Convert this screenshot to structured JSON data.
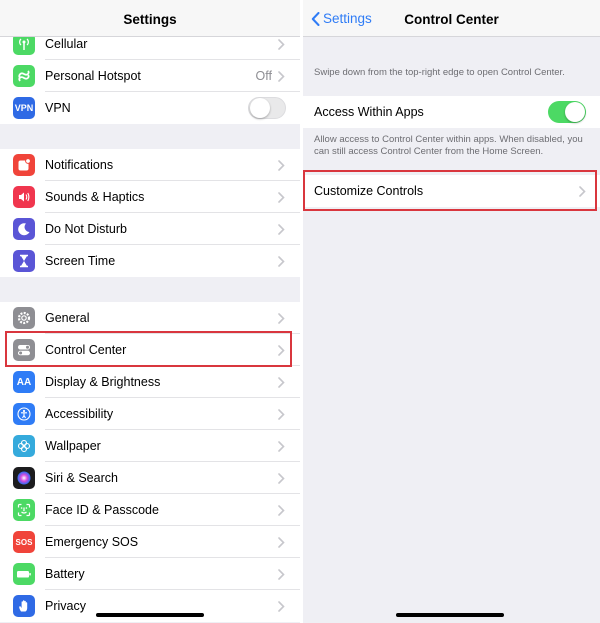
{
  "left": {
    "title": "Settings",
    "group1": [
      {
        "label": "Cellular",
        "icon": "antenna-icon",
        "color": "#4cd964"
      },
      {
        "label": "Personal Hotspot",
        "icon": "hotspot-icon",
        "color": "#4cd964",
        "value": "Off"
      },
      {
        "label": "VPN",
        "icon": "vpn-icon",
        "color": "#2f6ae5",
        "icon_text": "VPN",
        "toggle": "off"
      }
    ],
    "group2": [
      {
        "label": "Notifications",
        "icon": "notifications-icon",
        "color": "#f0443a"
      },
      {
        "label": "Sounds & Haptics",
        "icon": "speaker-icon",
        "color": "#f0364e"
      },
      {
        "label": "Do Not Disturb",
        "icon": "moon-icon",
        "color": "#5a55d6"
      },
      {
        "label": "Screen Time",
        "icon": "hourglass-icon",
        "color": "#5a55d6"
      }
    ],
    "group3": [
      {
        "label": "General",
        "icon": "gear-icon",
        "color": "#8e8e93"
      },
      {
        "label": "Control Center",
        "icon": "control-center-icon",
        "color": "#8e8e93"
      },
      {
        "label": "Display & Brightness",
        "icon": "display-icon",
        "color": "#2f7cf6",
        "icon_text": "AA"
      },
      {
        "label": "Accessibility",
        "icon": "accessibility-icon",
        "color": "#2f7cf6"
      },
      {
        "label": "Wallpaper",
        "icon": "wallpaper-icon",
        "color": "#35aadc"
      },
      {
        "label": "Siri & Search",
        "icon": "siri-icon",
        "color": "#1c1c1e"
      },
      {
        "label": "Face ID & Passcode",
        "icon": "face-id-icon",
        "color": "#4cd964"
      },
      {
        "label": "Emergency SOS",
        "icon": "sos-icon",
        "color": "#f0443a",
        "icon_text": "SOS"
      },
      {
        "label": "Battery",
        "icon": "battery-icon",
        "color": "#4cd964"
      },
      {
        "label": "Privacy",
        "icon": "hand-icon",
        "color": "#2f6ae5"
      }
    ]
  },
  "right": {
    "back_label": "Settings",
    "title": "Control Center",
    "intro": "Swipe down from the top-right edge to open Control Center.",
    "access_label": "Access Within Apps",
    "access_toggle": "on",
    "access_footer": "Allow access to Control Center within apps. When disabled, you can still access Control Center from the Home Screen.",
    "customize_label": "Customize Controls"
  },
  "colors": {
    "accent": "#2f7cf6",
    "toggle_on": "#4cd964",
    "highlight": "#d9363e"
  }
}
